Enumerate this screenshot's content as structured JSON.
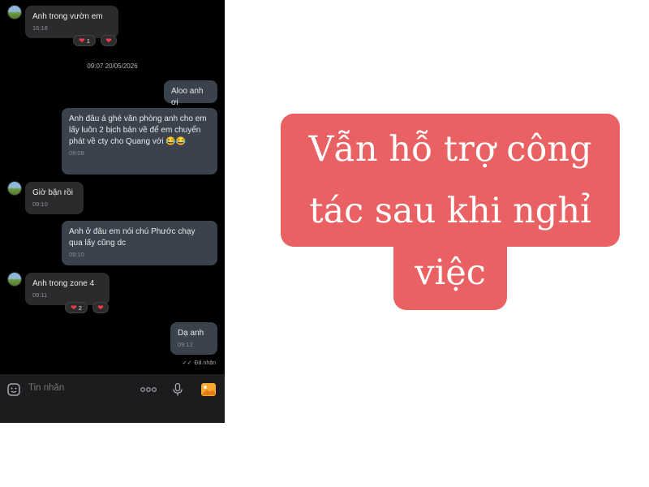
{
  "messages": [
    {
      "text": "Anh trong vườn em",
      "time": "16:18",
      "reaction_count": "1"
    },
    {
      "text": "Aloo anh ơi"
    },
    {
      "text": "Anh đâu á ghé văn phòng anh cho em lấy luôn 2 bịch bản về để em chuyển phát về cty cho Quang với 😂😂",
      "time": "09:08"
    },
    {
      "text": "Giờ bận rồi",
      "time": "09:10"
    },
    {
      "text": "Anh ở đâu em nói chú Phước chạy qua lấy cũng dc",
      "time": "09:10"
    },
    {
      "text": "Anh trong zone 4",
      "time": "09:11",
      "reaction_count": "2"
    },
    {
      "text": "Dạ anh",
      "time": "09:12"
    }
  ],
  "date_divider": "09:07 20/05/2026",
  "status": "Đã nhận",
  "input": {
    "placeholder": "Tin nhắn"
  },
  "icons": [
    "emoji-icon",
    "more-icon",
    "microphone-icon",
    "image-icon"
  ],
  "banner": {
    "line1": "Vẫn hỗ trợ công",
    "line2": "tác sau khi nghỉ",
    "line3": "việc",
    "color": "#e96162"
  }
}
